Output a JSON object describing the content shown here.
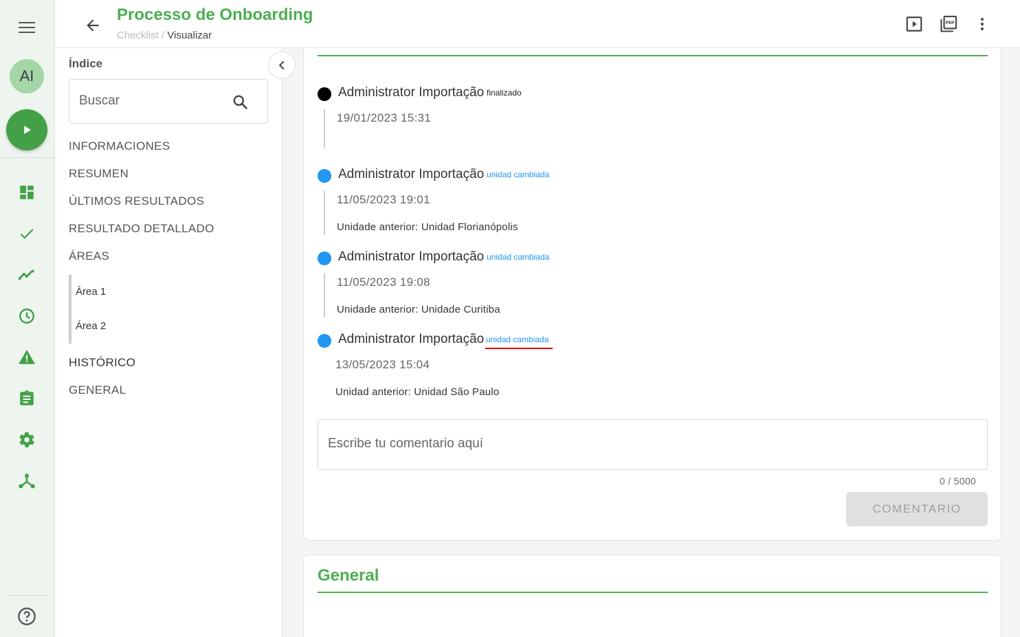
{
  "header": {
    "title": "Processo de Onboarding",
    "breadcrumb_parent": "Checklist",
    "breadcrumb_separator": " / ",
    "breadcrumb_current": "Visualizar"
  },
  "rail": {
    "avatar_initials": "AI"
  },
  "index": {
    "label": "Índice",
    "search_placeholder": "Buscar",
    "items": [
      "INFORMACIONES",
      "RESUMEN",
      "ÚLTIMOS RESULTADOS",
      "RESULTADO DETALLADO",
      "ÁREAS"
    ],
    "sub_items": [
      "Área 1",
      "Área 2"
    ],
    "items_after": [
      "HISTÓRICO",
      "GENERAL"
    ]
  },
  "history": [
    {
      "user": "Administrator Importação",
      "tag": "finalizado",
      "date": "19/01/2023 15:31",
      "detail": "",
      "dot_color": "#000000",
      "tag_color": "#222222"
    },
    {
      "user": "Administrator Importação",
      "tag": "unidad cambiada",
      "date": "11/05/2023 19:01",
      "detail": "Unidade anterior: Unidad Florianópolis",
      "dot_color": "#2196f3",
      "tag_color": "#2196f3"
    },
    {
      "user": "Administrator Importação",
      "tag": "unidad cambiada",
      "date": "11/05/2023 19:08",
      "detail": "Unidade anterior: Unidade Curitiba",
      "dot_color": "#2196f3",
      "tag_color": "#2196f3"
    },
    {
      "user": "Administrator Importação",
      "tag": "unidad cambiada",
      "date": "13/05/2023 15:04",
      "detail": "Unidad anterior: Unidad São Paulo",
      "dot_color": "#2196f3",
      "tag_color": "#2196f3"
    }
  ],
  "comment": {
    "placeholder": "Escribe tu comentario aquí",
    "counter": "0 / 5000",
    "button_label": "COMENTARIO"
  },
  "general_section": {
    "title": "General"
  },
  "colors": {
    "accent": "#4caf50",
    "highlight_underline": "#e00000"
  }
}
